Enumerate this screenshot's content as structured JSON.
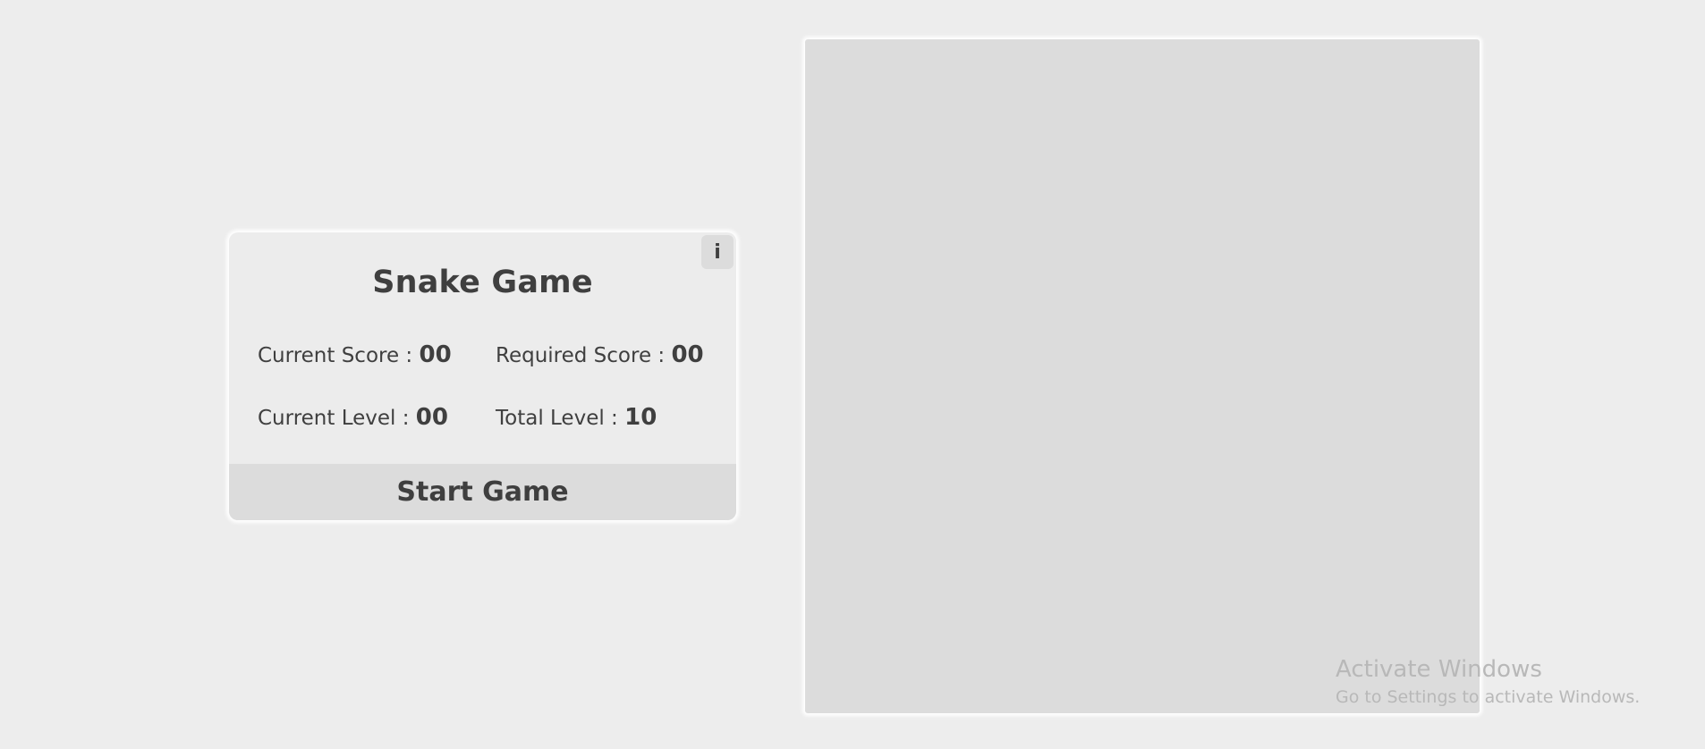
{
  "panel": {
    "info_label": "i",
    "title": "Snake Game",
    "stats": {
      "current_score_label": "Current Score :",
      "current_score_value": "00",
      "required_score_label": "Required Score :",
      "required_score_value": "00",
      "current_level_label": "Current Level :",
      "current_level_value": "00",
      "total_level_label": "Total Level :",
      "total_level_value": "10"
    },
    "start_label": "Start Game"
  },
  "watermark": {
    "title": "Activate Windows",
    "subtitle": "Go to Settings to activate Windows."
  },
  "colors": {
    "background": "#ededed",
    "panel": "#ececec",
    "button": "#dcdcdc",
    "board": "#dcdcdc",
    "text": "#3f3f3f"
  }
}
